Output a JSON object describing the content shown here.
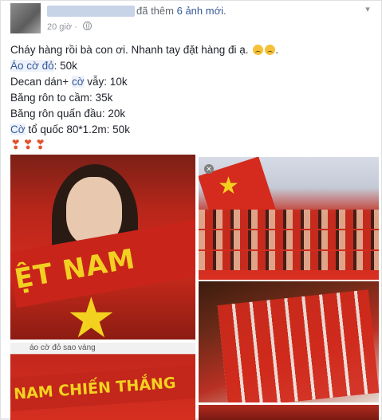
{
  "post": {
    "header_action": "đã thêm",
    "header_link": "6 ảnh mới.",
    "time": "20 giờ",
    "lines": {
      "l1": "Cháy hàng rồi bà con ơi. Nhanh tay đặt hàng đi ạ.",
      "l2_a": "Áo cờ đỏ",
      "l2_b": ": 50k",
      "l3_a": "Decan dán+ ",
      "l3_b": "cờ",
      "l3_c": " vẫy: 10k",
      "l4": "Băng rôn to cầm: 35k",
      "l5": "Băng rôn quấn đầu: 20k",
      "l6_a": "Cờ",
      "l6_b": " tổ quốc 80*1.2m: 50k"
    },
    "hearts": "❣❣❣"
  },
  "photos": {
    "scarf_text": "ỆT NAM",
    "search_text": "áo cờ đỏ sao vàng",
    "banner_text": "NAM CHIẾN THẮNG"
  },
  "colors": {
    "link": "#365899",
    "flag_red": "#d52b1e",
    "flag_yellow": "#f3d21f"
  },
  "icons": [
    "globe-icon",
    "chevron-down-icon",
    "close-icon",
    "sad-emoji-icon",
    "heart-icon"
  ]
}
